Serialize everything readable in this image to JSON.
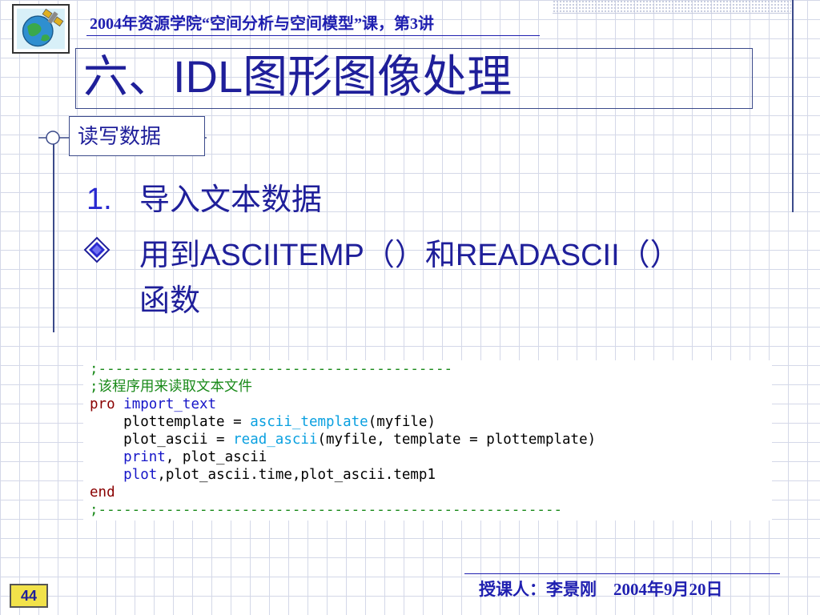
{
  "header": {
    "course": "2004年资源学院“空间分析与空间模型”课，第3讲"
  },
  "logo": {
    "icon": "globe-satellite-icon"
  },
  "title": "六、IDL图形图像处理",
  "section": {
    "label": "读写数据"
  },
  "content": {
    "item_number": "1.",
    "item_text": "导入文本数据",
    "bullet_icon": "diamond-bullet-icon",
    "bullet_prefix": "用到",
    "bullet_func1": "ASCIITEMP",
    "bullet_paren1": "（）和",
    "bullet_func2": "READASCII",
    "bullet_paren2": "（）",
    "bullet_suffix": "函数"
  },
  "code": {
    "line1": ";------------------------------------------",
    "line2": ";该程序用来读取文本文件",
    "line3_kw": "pro",
    "line3_name": "import_text",
    "line4_a": "    plottemplate = ",
    "line4_fn": "ascii_template",
    "line4_b": "(myfile)",
    "line5_a": "    plot_ascii = ",
    "line5_fn": "read_ascii",
    "line5_b": "(myfile, template = plottemplate)",
    "line6_fn": "print",
    "line6_b": ", plot_ascii",
    "line7_fn": "plot",
    "line7_b": ",plot_ascii.time,plot_ascii.temp1",
    "line8_kw": "end",
    "line9": ";-------------------------------------------------------"
  },
  "footer": {
    "text": "授课人：李景刚    2004年9月20日",
    "page_number": "44"
  },
  "colors": {
    "title": "#1f1f9a",
    "header": "#1f1fb0",
    "comment": "#1a8a1a",
    "keyword": "#8a0000",
    "function": "#1616c8",
    "builtin": "#0aa0e0",
    "page_badge": "#f2e24a"
  }
}
